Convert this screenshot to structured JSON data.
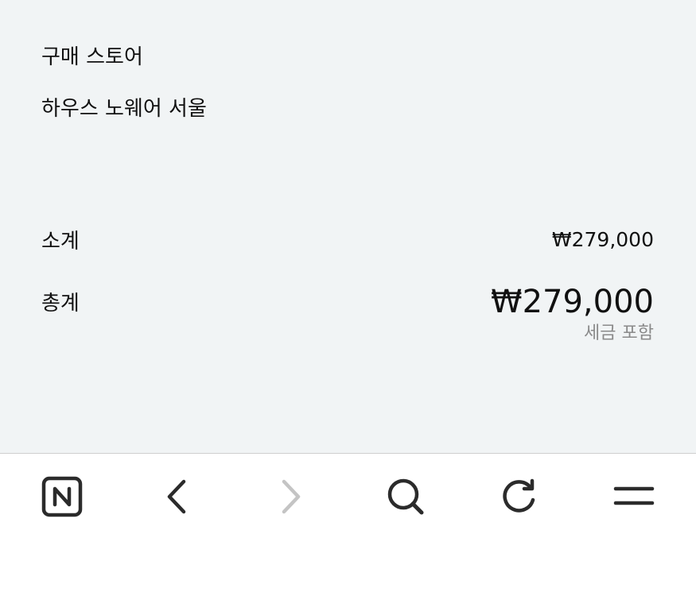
{
  "order": {
    "store_label": "구매 스토어",
    "store_name": "하우스 노웨어 서울",
    "subtotal_label": "소계",
    "subtotal_value": "₩279,000",
    "total_label": "총계",
    "total_value": "₩279,000",
    "tax_note": "세금 포함"
  },
  "browser_toolbar": {
    "buttons": [
      {
        "name": "naver-home-button",
        "icon": "naver-n-icon",
        "enabled": true
      },
      {
        "name": "back-button",
        "icon": "chevron-left-icon",
        "enabled": true
      },
      {
        "name": "forward-button",
        "icon": "chevron-right-icon",
        "enabled": false
      },
      {
        "name": "search-button",
        "icon": "search-icon",
        "enabled": true
      },
      {
        "name": "reload-button",
        "icon": "reload-icon",
        "enabled": true
      },
      {
        "name": "menu-button",
        "icon": "menu-icon",
        "enabled": true
      }
    ]
  },
  "colors": {
    "content_background": "#f1f4f5",
    "text_primary": "#111111",
    "text_secondary": "#8a8a8a",
    "icon_active": "#2b2b2b",
    "icon_disabled": "#c4c4c4"
  }
}
